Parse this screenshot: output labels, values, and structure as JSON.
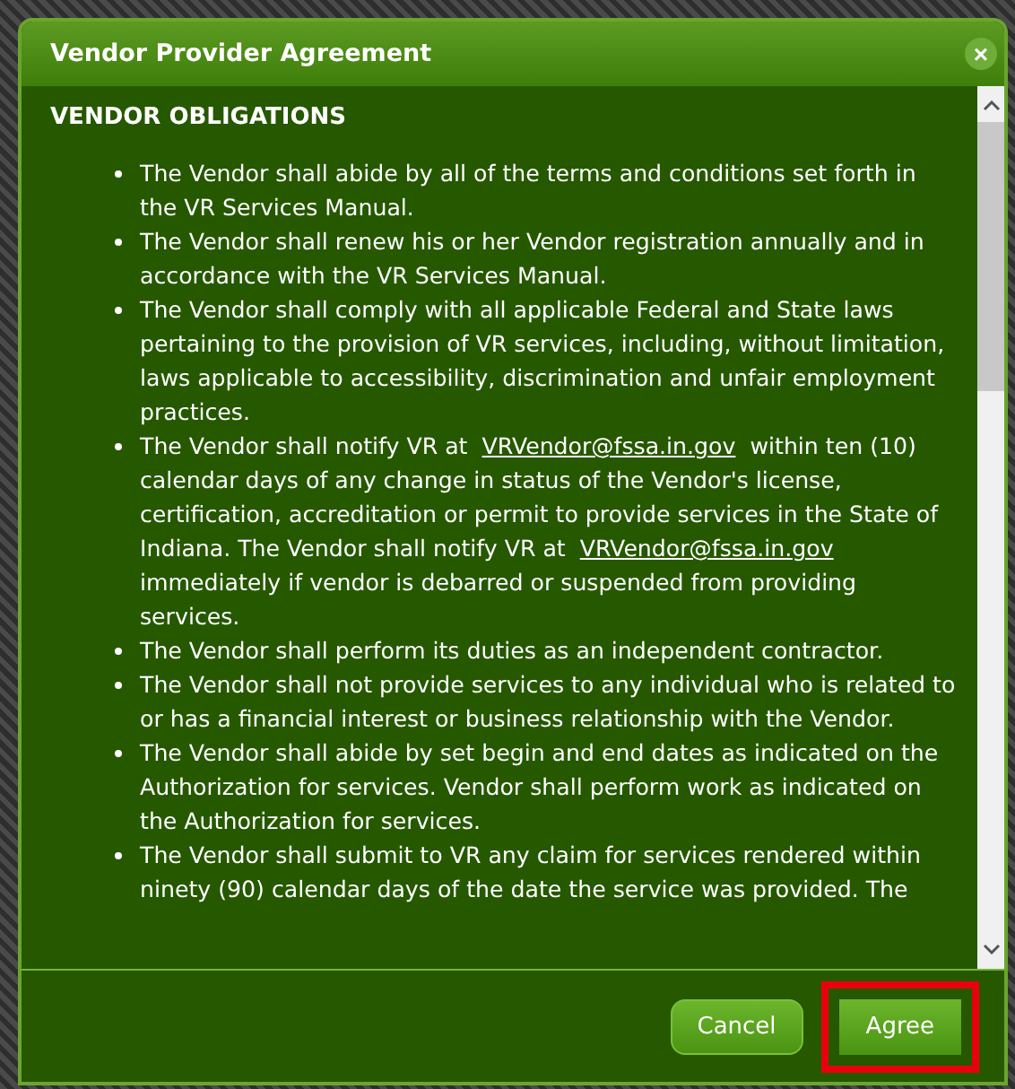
{
  "dialog": {
    "title": "Vendor Provider Agreement",
    "close": "×"
  },
  "section_heading": "VENDOR OBLIGATIONS",
  "bullets": [
    [
      {
        "kind": "text",
        "text": "The Vendor shall abide by all of the terms and conditions set forth in the VR Services Manual."
      }
    ],
    [
      {
        "kind": "text",
        "text": "The Vendor shall renew his or her Vendor registration annually and in accordance with the VR Services Manual."
      }
    ],
    [
      {
        "kind": "text",
        "text": "The Vendor shall comply with all applicable Federal and State laws pertaining to the provision of VR services, including, without limitation, laws applicable to accessibility, discrimination and unfair employment practices."
      }
    ],
    [
      {
        "kind": "text",
        "text": "The Vendor shall notify VR at "
      },
      {
        "kind": "link",
        "text": "VRVendor@fssa.in.gov"
      },
      {
        "kind": "text",
        "text": " within ten (10) calendar days of any change in status of the Vendor's license, certification, accreditation or permit to provide services in the State of Indiana. The Vendor shall notify VR at "
      },
      {
        "kind": "link",
        "text": "VRVendor@fssa.in.gov"
      },
      {
        "kind": "text",
        "text": " immediately if vendor is debarred or suspended from providing services."
      }
    ],
    [
      {
        "kind": "text",
        "text": "The Vendor shall perform its duties as an independent contractor."
      }
    ],
    [
      {
        "kind": "text",
        "text": "The Vendor shall not provide services to any individual who is related to or has a financial interest or business relationship with the Vendor."
      }
    ],
    [
      {
        "kind": "text",
        "text": "The Vendor shall abide by set begin and end dates as indicated on the Authorization for services. Vendor shall perform work as indicated on the Authorization for services."
      }
    ],
    [
      {
        "kind": "text",
        "text": "The Vendor shall submit to VR any claim for services rendered within ninety (90) calendar days of the date the service was provided. The"
      }
    ]
  ],
  "buttons": [
    {
      "label": "Cancel",
      "highlighted": false
    },
    {
      "label": "Agree",
      "highlighted": true
    }
  ]
}
